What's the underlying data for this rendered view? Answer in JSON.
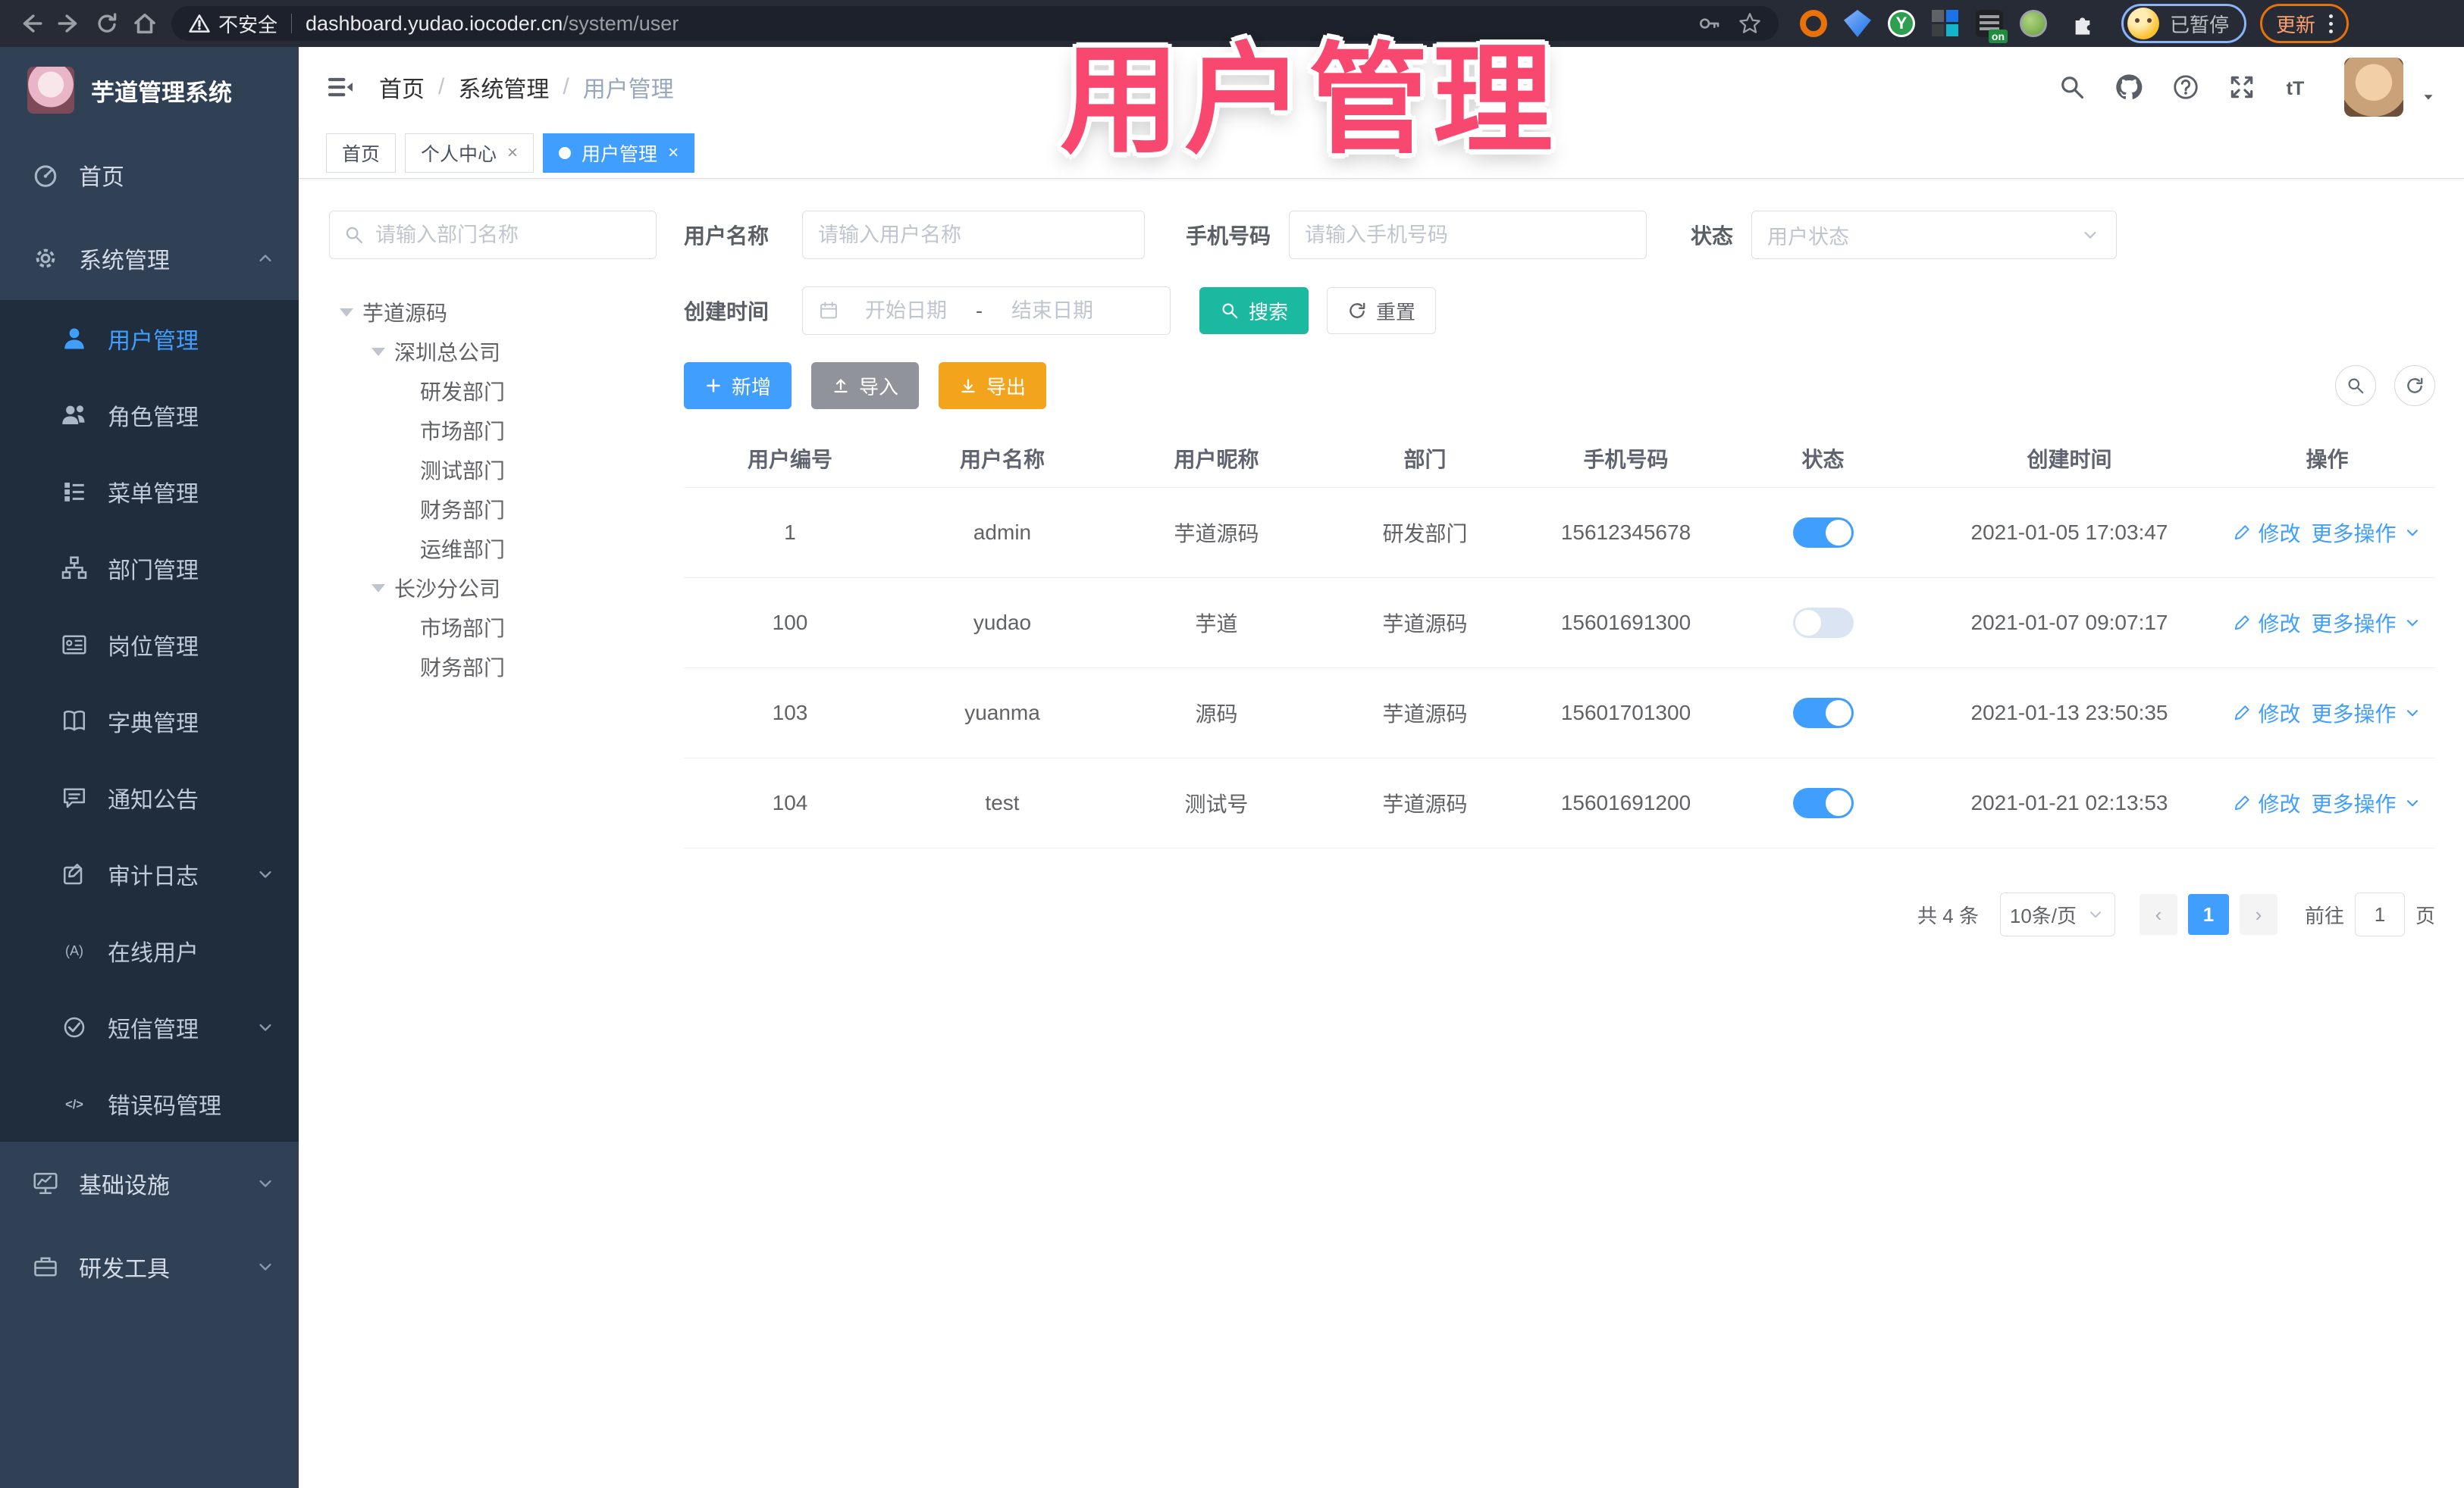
{
  "browser": {
    "security_label": "不安全",
    "url_domain": "dashboard.yudao.iocoder.cn",
    "url_path": "/system/user",
    "profile_status": "已暂停",
    "update_label": "更新"
  },
  "overlay": {
    "title": "用户管理"
  },
  "sidebar": {
    "logo_title": "芋道管理系统",
    "items": [
      {
        "label": "首页"
      },
      {
        "label": "系统管理"
      },
      {
        "label": "基础设施"
      },
      {
        "label": "研发工具"
      }
    ],
    "sub_items": [
      {
        "label": "用户管理"
      },
      {
        "label": "角色管理"
      },
      {
        "label": "菜单管理"
      },
      {
        "label": "部门管理"
      },
      {
        "label": "岗位管理"
      },
      {
        "label": "字典管理"
      },
      {
        "label": "通知公告"
      },
      {
        "label": "审计日志"
      },
      {
        "label": "在线用户"
      },
      {
        "label": "短信管理"
      },
      {
        "label": "错误码管理"
      }
    ]
  },
  "header": {
    "breadcrumb": [
      "首页",
      "系统管理",
      "用户管理"
    ]
  },
  "tabs": [
    {
      "label": "首页"
    },
    {
      "label": "个人中心",
      "close": "×"
    },
    {
      "label": "用户管理",
      "close": "×"
    }
  ],
  "tree": {
    "search_placeholder": "请输入部门名称",
    "nodes": [
      {
        "label": "芋道源码"
      },
      {
        "label": "深圳总公司"
      },
      {
        "label": "研发部门"
      },
      {
        "label": "市场部门"
      },
      {
        "label": "测试部门"
      },
      {
        "label": "财务部门"
      },
      {
        "label": "运维部门"
      },
      {
        "label": "长沙分公司"
      },
      {
        "label": "市场部门"
      },
      {
        "label": "财务部门"
      }
    ]
  },
  "filters": {
    "username_label": "用户名称",
    "username_placeholder": "请输入用户名称",
    "mobile_label": "手机号码",
    "mobile_placeholder": "请输入手机号码",
    "status_label": "状态",
    "status_placeholder": "用户状态",
    "date_label": "创建时间",
    "date_start_placeholder": "开始日期",
    "date_separator": "-",
    "date_end_placeholder": "结束日期",
    "search_label": "搜索",
    "reset_label": "重置"
  },
  "toolbar": {
    "add_label": "新增",
    "import_label": "导入",
    "export_label": "导出"
  },
  "table": {
    "columns": [
      "用户编号",
      "用户名称",
      "用户昵称",
      "部门",
      "手机号码",
      "状态",
      "创建时间",
      "操作"
    ],
    "edit_label": "修改",
    "more_label": "更多操作",
    "rows": [
      {
        "id": "1",
        "username": "admin",
        "nickname": "芋道源码",
        "dept": "研发部门",
        "mobile": "15612345678",
        "status": "on",
        "created": "2021-01-05 17:03:47"
      },
      {
        "id": "100",
        "username": "yudao",
        "nickname": "芋道",
        "dept": "芋道源码",
        "mobile": "15601691300",
        "status": "off",
        "created": "2021-01-07 09:07:17"
      },
      {
        "id": "103",
        "username": "yuanma",
        "nickname": "源码",
        "dept": "芋道源码",
        "mobile": "15601701300",
        "status": "on",
        "created": "2021-01-13 23:50:35"
      },
      {
        "id": "104",
        "username": "test",
        "nickname": "测试号",
        "dept": "芋道源码",
        "mobile": "15601691200",
        "status": "on",
        "created": "2021-01-21 02:13:53"
      }
    ]
  },
  "pagination": {
    "total": "共 4 条",
    "page_size": "10条/页",
    "page": "1",
    "goto_label": "前往",
    "goto_value": "1",
    "unit_label": "页"
  },
  "colors": {
    "accent": "#409eff",
    "search_button": "#1ab9a0",
    "export_button": "#f2a51c",
    "sidebar_bg": "#304156",
    "submenu_bg": "#1f2d3d",
    "overlay_pink": "#f8486f"
  }
}
